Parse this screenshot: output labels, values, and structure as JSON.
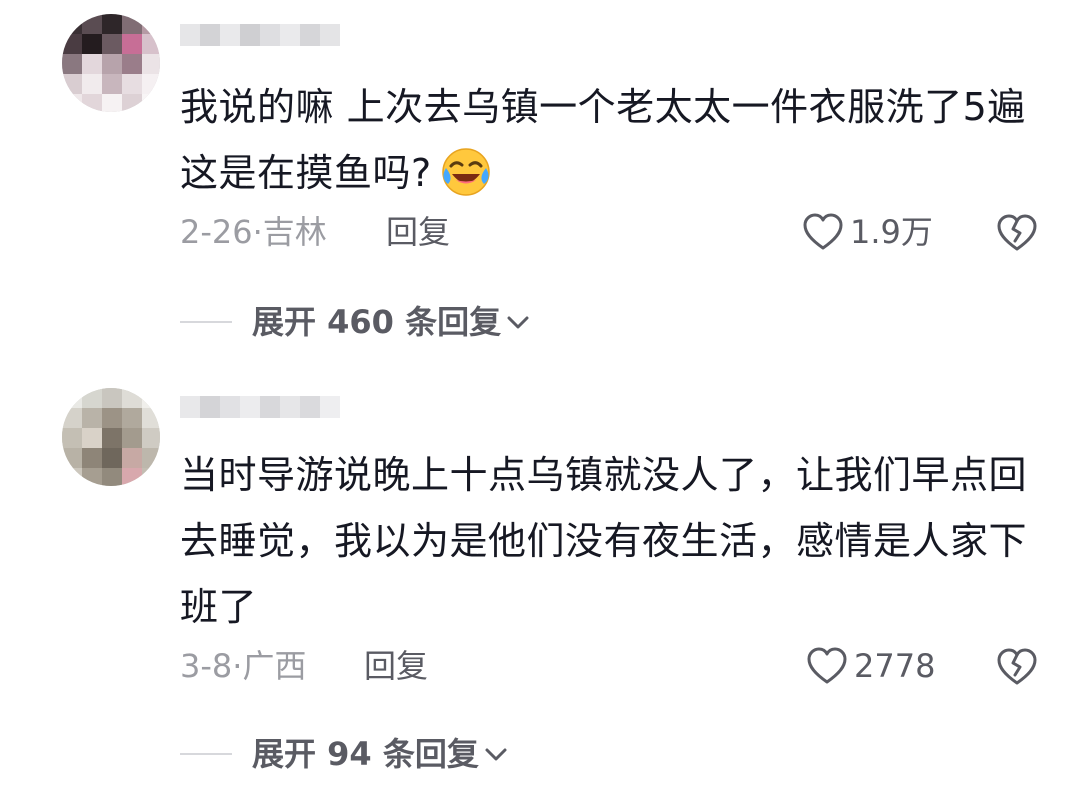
{
  "comments": [
    {
      "text_lines": [
        "我说的嘛  上次去乌镇一个老太太一件衣服洗了5遍",
        "这是在摸鱼吗?"
      ],
      "emoji": "laughing-tears-emoji",
      "date_location": "2-26·吉林",
      "reply_label": "回复",
      "like_count": "1.9万",
      "expand_label": "展开 460 条回复"
    },
    {
      "text_lines": [
        "当时导游说晚上十点乌镇就没人了，让我们早点回",
        "去睡觉，我以为是他们没有夜生活，感情是人家下",
        "班了"
      ],
      "date_location": "3-8·广西",
      "reply_label": "回复",
      "like_count": "2778",
      "expand_label": "展开 94 条回复"
    }
  ],
  "icons": {
    "like": "heart-outline-icon",
    "dislike": "broken-heart-icon",
    "expand": "chevron-down-icon"
  },
  "colors": {
    "text_primary": "#161823",
    "text_meta": "#9b9ca2",
    "text_secondary": "#5a5b63",
    "divider": "#d7d8dc"
  }
}
